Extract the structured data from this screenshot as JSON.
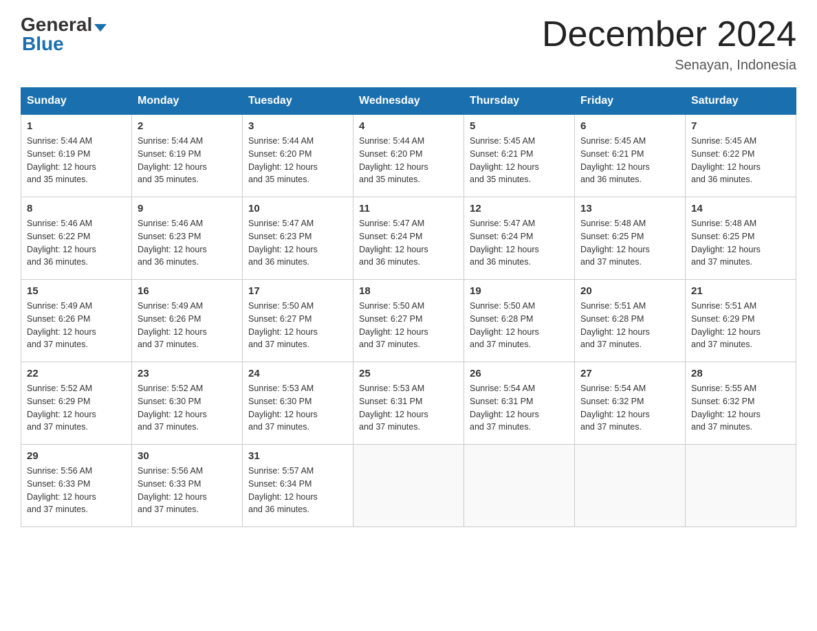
{
  "header": {
    "logo_brand": "General",
    "logo_blue": "Blue",
    "month_title": "December 2024",
    "location": "Senayan, Indonesia"
  },
  "calendar": {
    "days_of_week": [
      "Sunday",
      "Monday",
      "Tuesday",
      "Wednesday",
      "Thursday",
      "Friday",
      "Saturday"
    ],
    "weeks": [
      [
        {
          "day": "1",
          "sunrise": "5:44 AM",
          "sunset": "6:19 PM",
          "daylight": "12 hours and 35 minutes."
        },
        {
          "day": "2",
          "sunrise": "5:44 AM",
          "sunset": "6:19 PM",
          "daylight": "12 hours and 35 minutes."
        },
        {
          "day": "3",
          "sunrise": "5:44 AM",
          "sunset": "6:20 PM",
          "daylight": "12 hours and 35 minutes."
        },
        {
          "day": "4",
          "sunrise": "5:44 AM",
          "sunset": "6:20 PM",
          "daylight": "12 hours and 35 minutes."
        },
        {
          "day": "5",
          "sunrise": "5:45 AM",
          "sunset": "6:21 PM",
          "daylight": "12 hours and 35 minutes."
        },
        {
          "day": "6",
          "sunrise": "5:45 AM",
          "sunset": "6:21 PM",
          "daylight": "12 hours and 36 minutes."
        },
        {
          "day": "7",
          "sunrise": "5:45 AM",
          "sunset": "6:22 PM",
          "daylight": "12 hours and 36 minutes."
        }
      ],
      [
        {
          "day": "8",
          "sunrise": "5:46 AM",
          "sunset": "6:22 PM",
          "daylight": "12 hours and 36 minutes."
        },
        {
          "day": "9",
          "sunrise": "5:46 AM",
          "sunset": "6:23 PM",
          "daylight": "12 hours and 36 minutes."
        },
        {
          "day": "10",
          "sunrise": "5:47 AM",
          "sunset": "6:23 PM",
          "daylight": "12 hours and 36 minutes."
        },
        {
          "day": "11",
          "sunrise": "5:47 AM",
          "sunset": "6:24 PM",
          "daylight": "12 hours and 36 minutes."
        },
        {
          "day": "12",
          "sunrise": "5:47 AM",
          "sunset": "6:24 PM",
          "daylight": "12 hours and 36 minutes."
        },
        {
          "day": "13",
          "sunrise": "5:48 AM",
          "sunset": "6:25 PM",
          "daylight": "12 hours and 37 minutes."
        },
        {
          "day": "14",
          "sunrise": "5:48 AM",
          "sunset": "6:25 PM",
          "daylight": "12 hours and 37 minutes."
        }
      ],
      [
        {
          "day": "15",
          "sunrise": "5:49 AM",
          "sunset": "6:26 PM",
          "daylight": "12 hours and 37 minutes."
        },
        {
          "day": "16",
          "sunrise": "5:49 AM",
          "sunset": "6:26 PM",
          "daylight": "12 hours and 37 minutes."
        },
        {
          "day": "17",
          "sunrise": "5:50 AM",
          "sunset": "6:27 PM",
          "daylight": "12 hours and 37 minutes."
        },
        {
          "day": "18",
          "sunrise": "5:50 AM",
          "sunset": "6:27 PM",
          "daylight": "12 hours and 37 minutes."
        },
        {
          "day": "19",
          "sunrise": "5:50 AM",
          "sunset": "6:28 PM",
          "daylight": "12 hours and 37 minutes."
        },
        {
          "day": "20",
          "sunrise": "5:51 AM",
          "sunset": "6:28 PM",
          "daylight": "12 hours and 37 minutes."
        },
        {
          "day": "21",
          "sunrise": "5:51 AM",
          "sunset": "6:29 PM",
          "daylight": "12 hours and 37 minutes."
        }
      ],
      [
        {
          "day": "22",
          "sunrise": "5:52 AM",
          "sunset": "6:29 PM",
          "daylight": "12 hours and 37 minutes."
        },
        {
          "day": "23",
          "sunrise": "5:52 AM",
          "sunset": "6:30 PM",
          "daylight": "12 hours and 37 minutes."
        },
        {
          "day": "24",
          "sunrise": "5:53 AM",
          "sunset": "6:30 PM",
          "daylight": "12 hours and 37 minutes."
        },
        {
          "day": "25",
          "sunrise": "5:53 AM",
          "sunset": "6:31 PM",
          "daylight": "12 hours and 37 minutes."
        },
        {
          "day": "26",
          "sunrise": "5:54 AM",
          "sunset": "6:31 PM",
          "daylight": "12 hours and 37 minutes."
        },
        {
          "day": "27",
          "sunrise": "5:54 AM",
          "sunset": "6:32 PM",
          "daylight": "12 hours and 37 minutes."
        },
        {
          "day": "28",
          "sunrise": "5:55 AM",
          "sunset": "6:32 PM",
          "daylight": "12 hours and 37 minutes."
        }
      ],
      [
        {
          "day": "29",
          "sunrise": "5:56 AM",
          "sunset": "6:33 PM",
          "daylight": "12 hours and 37 minutes."
        },
        {
          "day": "30",
          "sunrise": "5:56 AM",
          "sunset": "6:33 PM",
          "daylight": "12 hours and 37 minutes."
        },
        {
          "day": "31",
          "sunrise": "5:57 AM",
          "sunset": "6:34 PM",
          "daylight": "12 hours and 36 minutes."
        },
        null,
        null,
        null,
        null
      ]
    ],
    "labels": {
      "sunrise": "Sunrise:",
      "sunset": "Sunset:",
      "daylight": "Daylight:"
    }
  }
}
